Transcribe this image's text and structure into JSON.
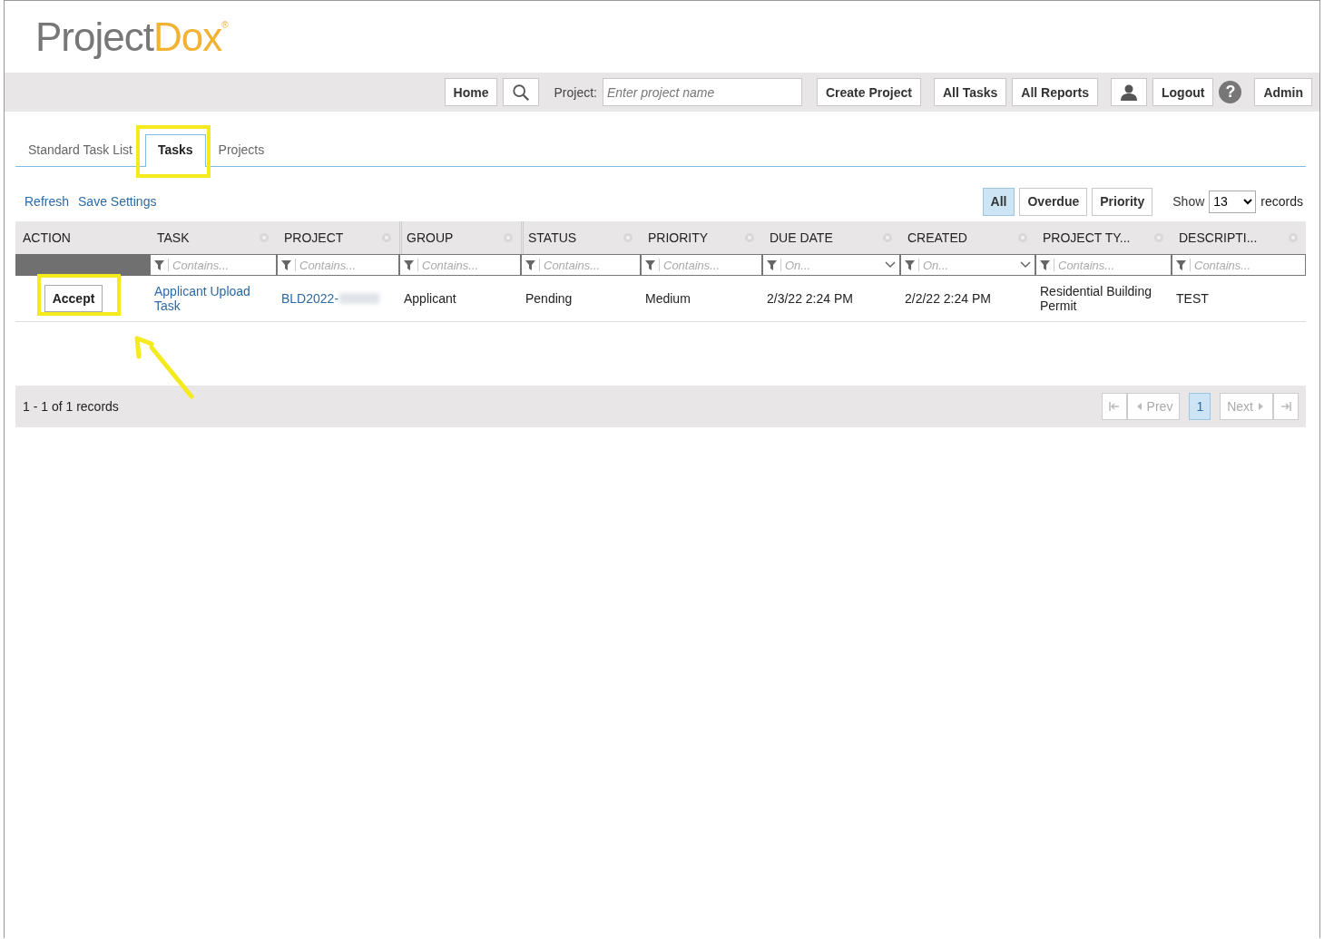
{
  "logo": {
    "part_1": "Project",
    "part_2": "Dox",
    "mark": "®"
  },
  "nav": {
    "buttons_left": [
      {
        "kind": "text",
        "label": "Home"
      },
      {
        "kind": "search"
      }
    ],
    "project_label": "Project:",
    "project_field": {
      "placeholder": "Enter project name"
    },
    "button_groups": [
      [
        {
          "kind": "text",
          "label": "Create Project"
        }
      ],
      [
        {
          "kind": "text",
          "label": "All Tasks"
        },
        {
          "kind": "text",
          "label": "All Reports"
        }
      ],
      [
        {
          "kind": "user"
        },
        {
          "kind": "text",
          "label": "Logout"
        },
        {
          "kind": "help",
          "label": "?"
        }
      ],
      [
        {
          "kind": "text",
          "label": "Admin"
        }
      ]
    ]
  },
  "tabs": [
    {
      "label": "Standard Task List",
      "selected": false,
      "highlighted": false
    },
    {
      "label": "Tasks",
      "selected": true,
      "highlighted": true
    },
    {
      "label": "Projects",
      "selected": false,
      "highlighted": false
    }
  ],
  "links": [
    "Refresh",
    "Save Settings"
  ],
  "filters": [
    {
      "label": "All",
      "selected": true
    },
    {
      "label": "Overdue",
      "selected": false
    },
    {
      "label": "Priority",
      "selected": false
    }
  ],
  "show": {
    "label": "Show",
    "value": "13",
    "suffix": "records"
  },
  "table": {
    "columns": [
      {
        "label": "ACTION",
        "kind": "nofilter",
        "gear": false
      },
      {
        "label": "TASK",
        "kind": "textfilter",
        "placeholder": "Contains...",
        "gear": true
      },
      {
        "label": "PROJECT",
        "kind": "textfilter",
        "placeholder": "Contains...",
        "gear": true
      },
      {
        "label": "GROUP",
        "kind": "textfilter",
        "placeholder": "Contains...",
        "gear": true
      },
      {
        "label": "STATUS",
        "kind": "textfilter",
        "placeholder": "Contains...",
        "gear": true
      },
      {
        "label": "PRIORITY",
        "kind": "textfilter",
        "placeholder": "Contains...",
        "gear": true
      },
      {
        "label": "DUE DATE",
        "kind": "datefilter",
        "placeholder": "On...",
        "gear": true
      },
      {
        "label": "CREATED",
        "kind": "datefilter",
        "placeholder": "On...",
        "gear": true
      },
      {
        "label": "PROJECT TY...",
        "kind": "textfilter",
        "placeholder": "Contains...",
        "gear": true
      },
      {
        "label": "DESCRIPTI...",
        "kind": "textfilter",
        "placeholder": "Contains...",
        "gear": true
      }
    ],
    "callout_arrow": true,
    "rows": [
      {
        "cells": [
          {
            "kind": "button",
            "text": "Accept",
            "highlighted": true
          },
          {
            "kind": "link",
            "text": "Applicant Upload Task"
          },
          {
            "kind": "redacted-link",
            "text": "BLD2022-"
          },
          {
            "kind": "text",
            "text": "Applicant"
          },
          {
            "kind": "text",
            "text": "Pending"
          },
          {
            "kind": "text",
            "text": "Medium"
          },
          {
            "kind": "text",
            "text": "2/3/22 2:24 PM"
          },
          {
            "kind": "text",
            "text": "2/2/22 2:24 PM"
          },
          {
            "kind": "text",
            "text": "Residential Building Permit"
          },
          {
            "kind": "text",
            "text": "TEST"
          }
        ]
      }
    ]
  },
  "footer": {
    "summary": "1 - 1 of 1 records",
    "pager": [
      {
        "kind": "first",
        "disabled": true
      },
      {
        "kind": "prev",
        "label": "Prev",
        "disabled": true
      },
      {
        "kind": "page",
        "label": "1",
        "selected": true
      },
      {
        "kind": "next",
        "label": "Next",
        "disabled": true
      },
      {
        "kind": "last",
        "disabled": true
      }
    ]
  }
}
